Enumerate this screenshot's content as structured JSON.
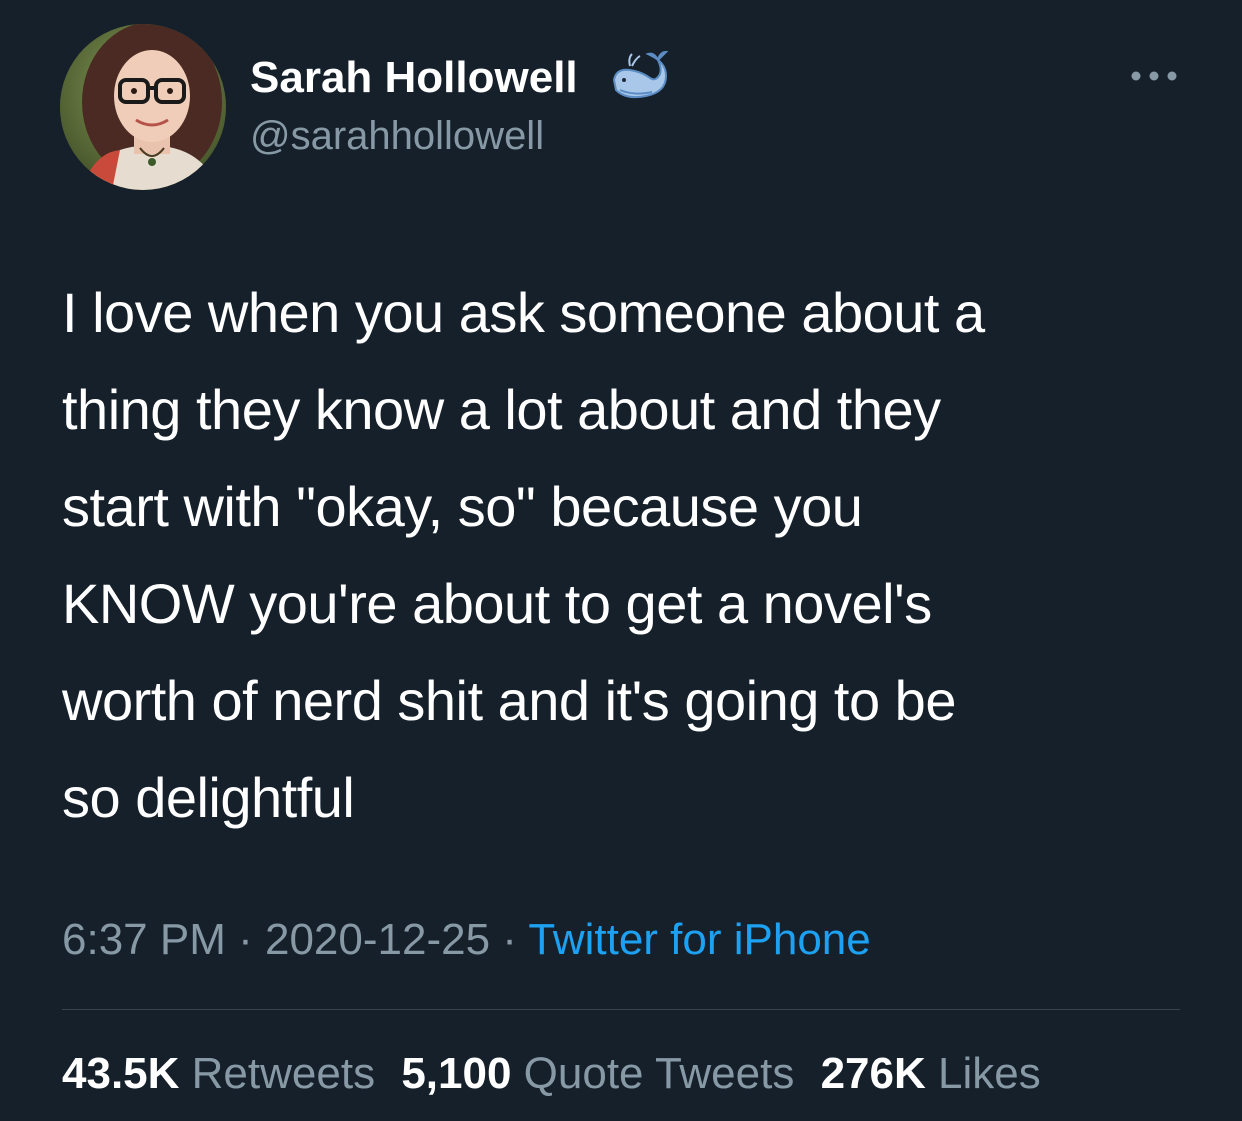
{
  "user": {
    "display_name": "Sarah Hollowell",
    "handle": "@sarahhollowell",
    "badge_icon": "whale-icon",
    "avatar_icon": "profile-photo"
  },
  "more_icon": "ellipsis-icon",
  "tweet": {
    "text": "I love when you ask someone about a\nthing they know a lot about and they\nstart with \"okay, so\" because you\nKNOW you're about to get a novel's\nworth of nerd shit and it's going to be\nso delightful"
  },
  "meta": {
    "time": "6:37 PM",
    "separator": " · ",
    "date": "2020-12-25",
    "source": "Twitter for iPhone"
  },
  "stats": {
    "retweets": {
      "count": "43.5K",
      "label": "Retweets"
    },
    "quote_tweets": {
      "count": "5,100",
      "label": "Quote Tweets"
    },
    "likes": {
      "count": "276K",
      "label": "Likes"
    }
  },
  "colors": {
    "background": "#15202b",
    "text_primary": "#ffffff",
    "text_secondary": "#8899a6",
    "link": "#1da1f2",
    "divider": "#38444d"
  }
}
